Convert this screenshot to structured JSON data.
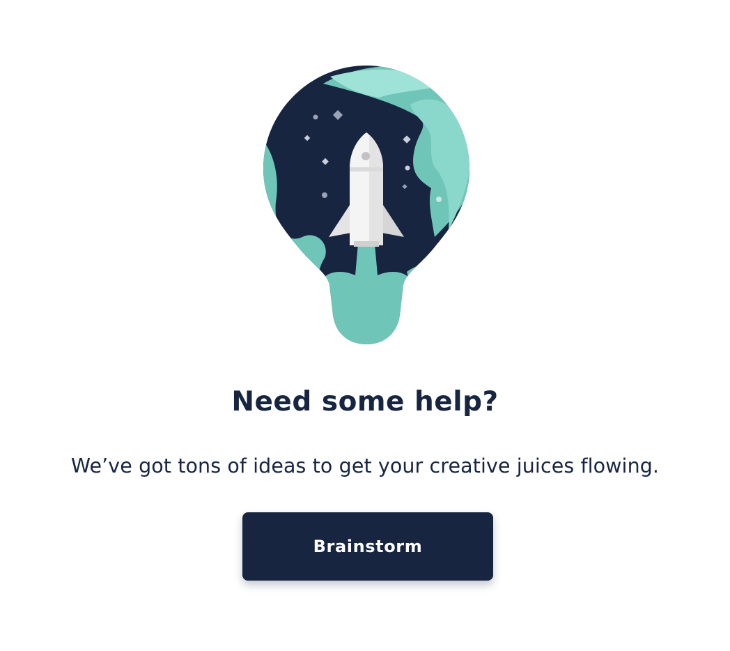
{
  "illustration": {
    "icon": "lightbulb-rocket-icon",
    "colors": {
      "bulb_dark": "#172541",
      "teal": "#6fc6b8",
      "teal_light": "#9fe3d8",
      "rocket": "#f2f2f2"
    }
  },
  "empty_state": {
    "title": "Need some help?",
    "subtitle": "We’ve got tons of ideas to get your creative juices flowing.",
    "button_label": "Brainstorm"
  },
  "colors": {
    "text": "#172541",
    "button_bg": "#172541",
    "button_text": "#ffffff",
    "background": "#ffffff"
  }
}
